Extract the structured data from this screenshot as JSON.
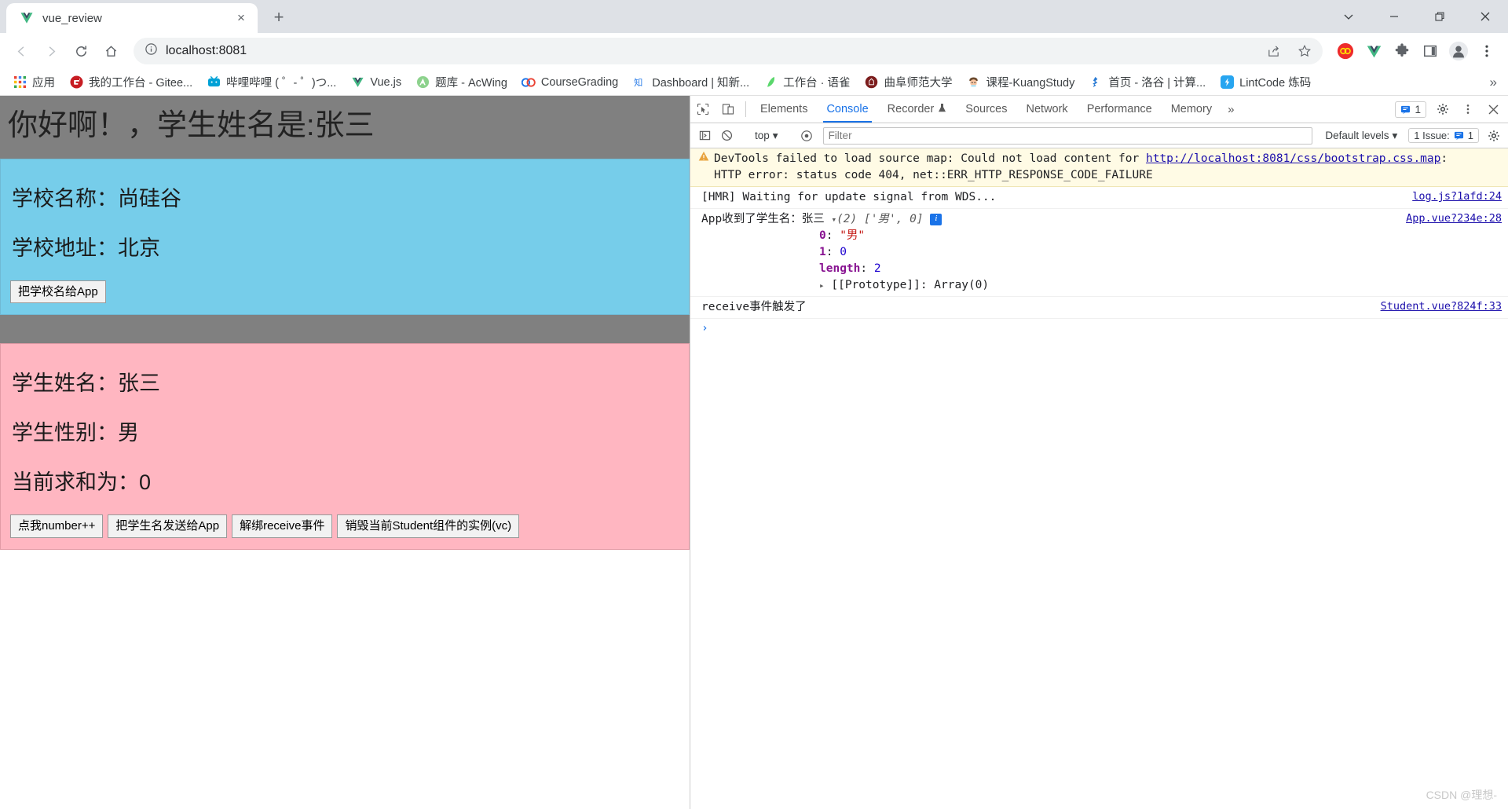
{
  "browser": {
    "tab": {
      "title": "vue_review",
      "favicon": "vue-logo-icon",
      "close": "×"
    },
    "new_tab_label": "+",
    "window_controls": {
      "expand": "⌄",
      "minimize": "—",
      "restore": "❐",
      "close": "✕"
    },
    "nav": {
      "back": "←",
      "forward": "→",
      "reload": "⟳",
      "home": "⌂",
      "site_info": "ⓘ",
      "url": "localhost:8081",
      "share": "share-icon",
      "bookmark_star": "★"
    },
    "extensions": [
      "infinity-ext-icon",
      "vue-devtools-icon",
      "puzzle-ext-icon",
      "side-panel-icon",
      "profile-avatar-icon",
      "chrome-menu-icon"
    ],
    "bookmarks": [
      {
        "label": "应用",
        "icon": "apps-grid-icon"
      },
      {
        "label": "我的工作台 - Gitee...",
        "icon": "gitee-icon"
      },
      {
        "label": "哔哩哔哩 ( ゜- ゜)つ...",
        "icon": "bilibili-icon"
      },
      {
        "label": "Vue.js",
        "icon": "vue-icon"
      },
      {
        "label": "题库 - AcWing",
        "icon": "acwing-icon"
      },
      {
        "label": "CourseGrading",
        "icon": "coursegrading-icon"
      },
      {
        "label": "Dashboard | 知新...",
        "icon": "zhixin-icon"
      },
      {
        "label": "工作台 · 语雀",
        "icon": "yuque-icon"
      },
      {
        "label": "曲阜师范大学",
        "icon": "qfnu-icon"
      },
      {
        "label": "课程-KuangStudy",
        "icon": "kuangstudy-icon"
      },
      {
        "label": "首页 - 洛谷 | 计算...",
        "icon": "luogu-icon"
      },
      {
        "label": "LintCode 炼码",
        "icon": "lintcode-icon"
      }
    ],
    "bookmarks_overflow": "»"
  },
  "page": {
    "app_title": "你好啊！，学生姓名是:张三",
    "school": {
      "name_line": "学校名称：尚硅谷",
      "address_line": "学校地址：北京",
      "button": "把学校名给App"
    },
    "student": {
      "name_line": "学生姓名：张三",
      "gender_line": "学生性别：男",
      "sum_line": "当前求和为：0",
      "buttons": [
        "点我number++",
        "把学生名发送给App",
        "解绑receive事件",
        "销毁当前Student组件的实例(vc)"
      ]
    }
  },
  "devtools": {
    "inspect_icon": "inspect-element-icon",
    "device_icon": "device-toolbar-icon",
    "tabs": [
      {
        "label": "Elements",
        "active": false
      },
      {
        "label": "Console",
        "active": true
      },
      {
        "label": "Recorder",
        "active": false,
        "badge": "recorder-flask-icon"
      },
      {
        "label": "Sources",
        "active": false
      },
      {
        "label": "Network",
        "active": false
      },
      {
        "label": "Performance",
        "active": false
      },
      {
        "label": "Memory",
        "active": false
      }
    ],
    "more_tabs": "»",
    "issues_count": "1",
    "settings_icon": "gear-icon",
    "more_icon": "kebab-menu-icon",
    "close_icon": "close-icon",
    "toolbar": {
      "clear_console": "clear-console-icon",
      "no_entry": "no-entry-icon",
      "context": "top",
      "context_caret": "▾",
      "eye": "live-expression-icon",
      "filter_placeholder": "Filter",
      "levels": "Default levels",
      "levels_caret": "▾",
      "issues_label": "1 Issue:",
      "issues_num": "1",
      "console_settings": "gear-icon"
    },
    "logs": {
      "warning": {
        "line1_a": "DevTools failed to load source map: Could not load content for ",
        "link": "http://localhost:8081/css/bootstrap.css.map",
        "line1_b": ":",
        "line2": "HTTP error: status code 404, net::ERR_HTTP_RESPONSE_CODE_FAILURE"
      },
      "hmr": {
        "message": "[HMR] Waiting for update signal from WDS...",
        "source": "log.js?1afd:24"
      },
      "app_received": {
        "prefix": "App收到了学生名：",
        "name": "张三",
        "caret": "▾",
        "count": "(2)",
        "array_preview": "['男', 0]",
        "info": "i",
        "source": "App.vue?234e:28",
        "entries": [
          {
            "key": "0",
            "value": "\"男\"",
            "type": "string"
          },
          {
            "key": "1",
            "value": "0",
            "type": "number"
          },
          {
            "key": "length",
            "value": "2",
            "type": "number"
          }
        ],
        "prototype": "[[Prototype]]: Array(0)",
        "prototype_caret": "▸"
      },
      "receive": {
        "message": "receive事件触发了",
        "source": "Student.vue?824f:33"
      }
    },
    "prompt": "›"
  },
  "watermark": "CSDN @理想-"
}
